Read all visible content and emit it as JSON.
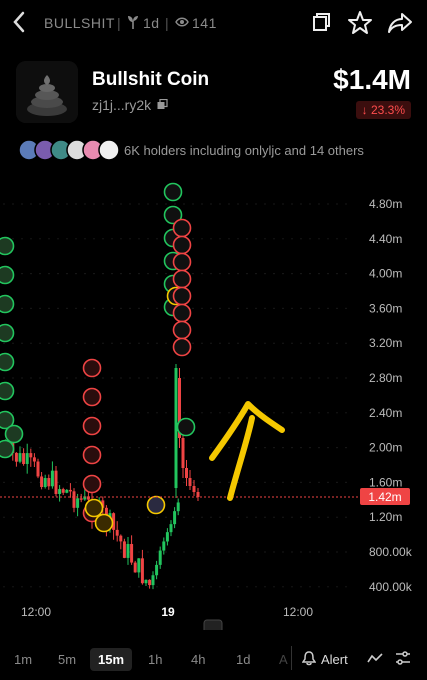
{
  "topbar": {
    "ticker": "BULLSHIT",
    "age": "1d",
    "views": "141",
    "icons": [
      "back-icon",
      "sprout-icon",
      "eye-icon",
      "share-icon",
      "star-icon",
      "forward-icon"
    ]
  },
  "token": {
    "name": "Bullshit Coin",
    "address": "zj1j...ry2k",
    "price": "$1.4M",
    "change": "↓ 23.3%",
    "change_color": "#ff4d4d"
  },
  "holders": {
    "text": "6K holders including onlyljc and 14 others",
    "avatar_count": 6
  },
  "chart_data": {
    "type": "candlestick",
    "y_ticks": [
      "4.80m",
      "4.40m",
      "4.00m",
      "3.60m",
      "3.20m",
      "2.80m",
      "2.40m",
      "2.00m",
      "1.60m",
      "1.20m",
      "800.00k",
      "400.00k"
    ],
    "current_label": "1.42m",
    "x_ticks": [
      "12:00",
      "19",
      "12:00"
    ],
    "up_color": "#22c55e",
    "down_color": "#ef4444",
    "annotation": "yellow arrow pointing up"
  },
  "timeframes": {
    "items": [
      "1m",
      "5m",
      "15m",
      "1h",
      "4h",
      "1d"
    ],
    "active": "15m",
    "alert_label": "Alert"
  }
}
